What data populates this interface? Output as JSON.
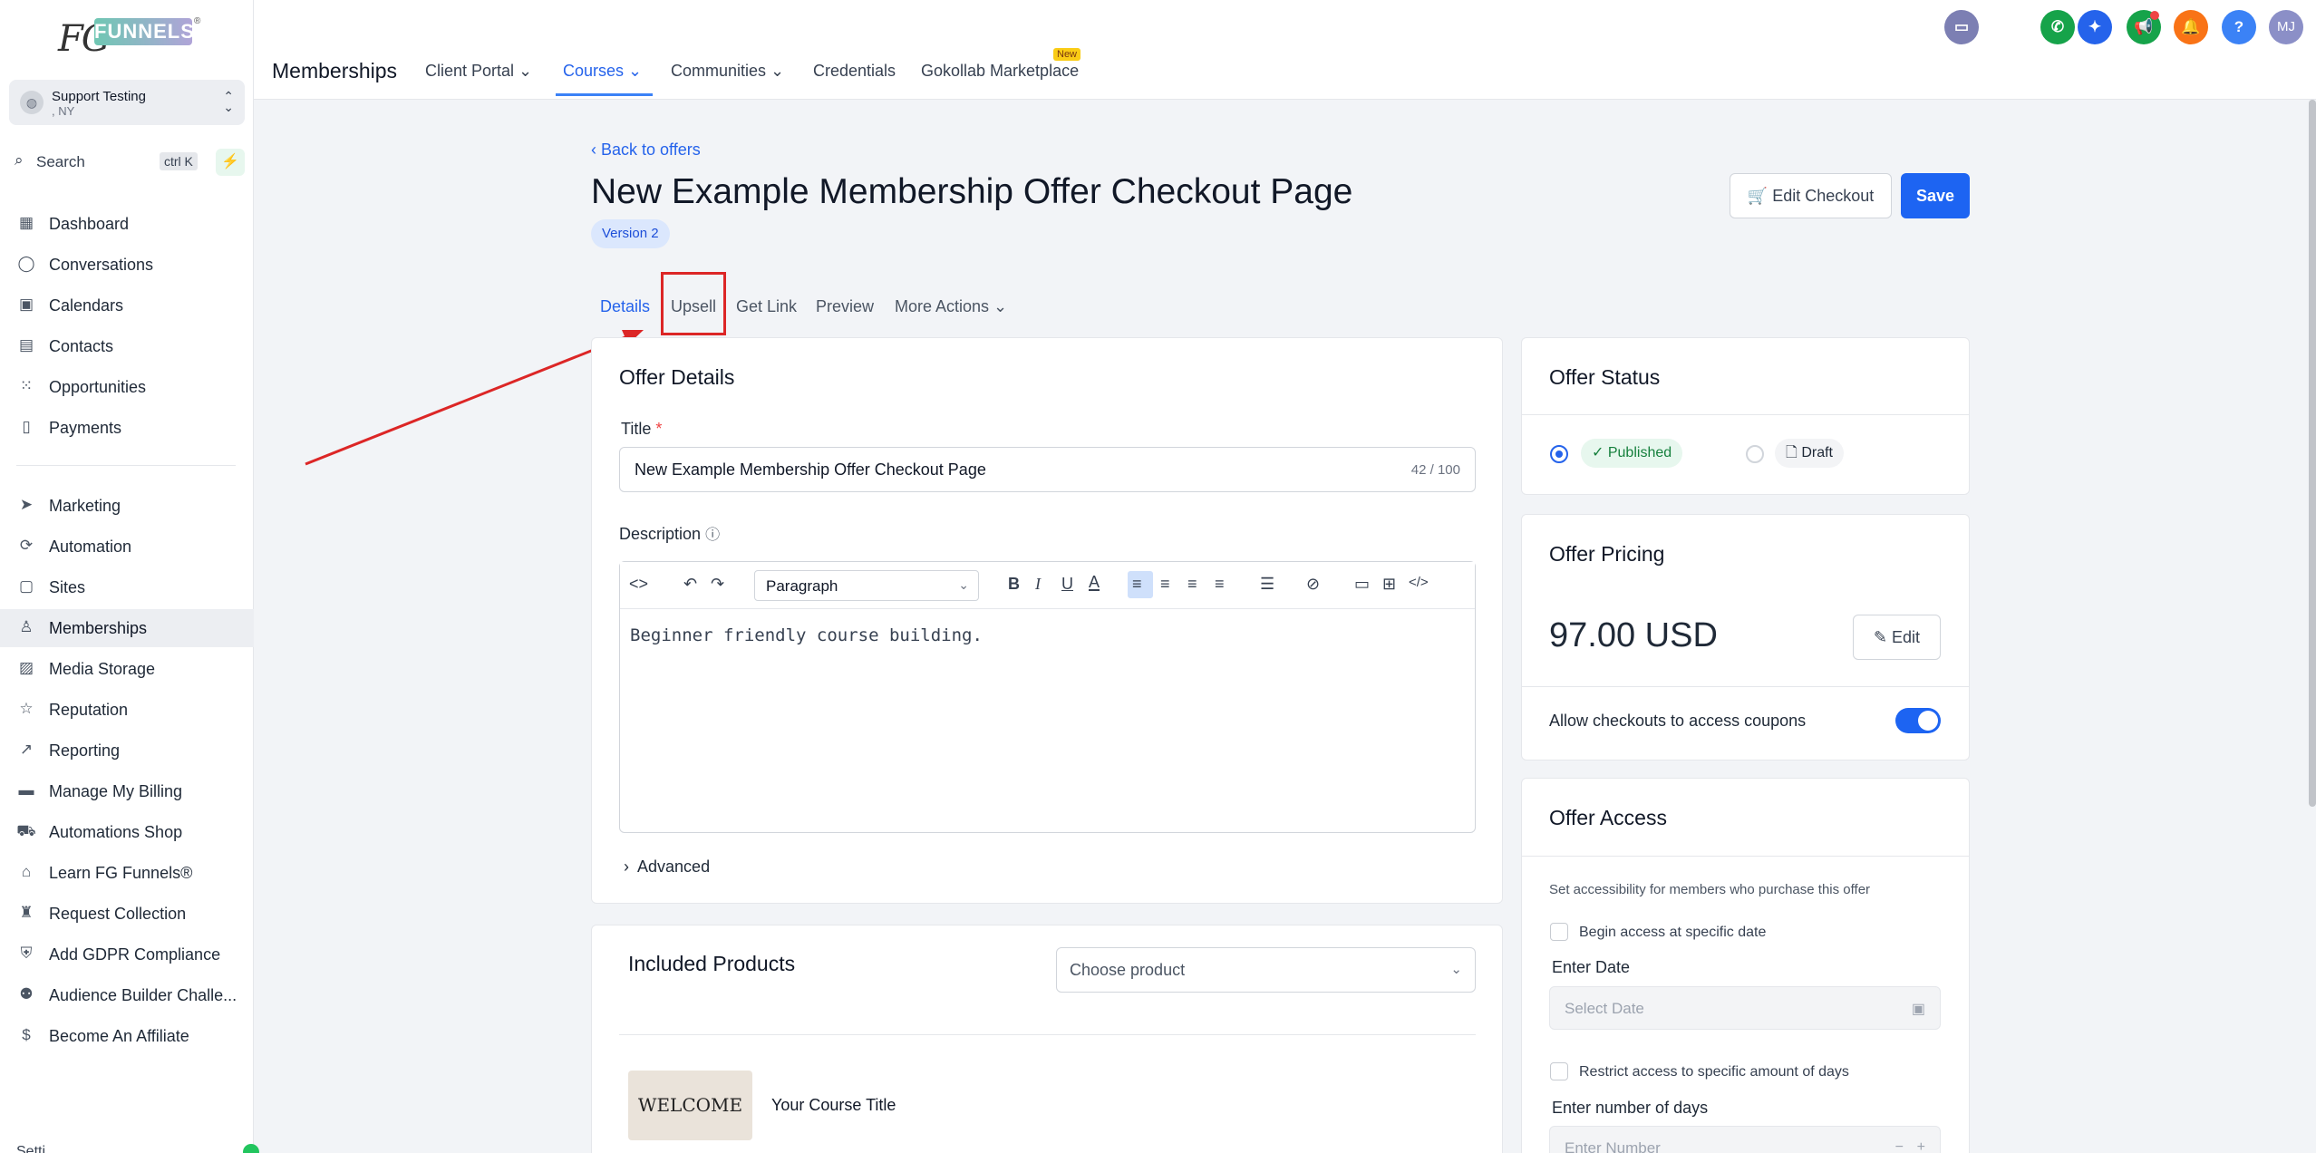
{
  "brand": {
    "logo_fg": "FG",
    "logo_funnels": "FUNNELS",
    "logo_mark": "®"
  },
  "account": {
    "name": "Support Testing",
    "location": ", NY"
  },
  "search": {
    "label": "Search",
    "shortcut": "ctrl K"
  },
  "sidebar": {
    "items": [
      {
        "label": "Dashboard",
        "icon": "dashboard-icon",
        "glyph": "▦"
      },
      {
        "label": "Conversations",
        "icon": "chat-icon",
        "glyph": "◯"
      },
      {
        "label": "Calendars",
        "icon": "calendar-icon",
        "glyph": "▣"
      },
      {
        "label": "Contacts",
        "icon": "contacts-icon",
        "glyph": "▤"
      },
      {
        "label": "Opportunities",
        "icon": "opportunities-icon",
        "glyph": "⁙"
      },
      {
        "label": "Payments",
        "icon": "payments-icon",
        "glyph": "▯"
      },
      {
        "label": "Marketing",
        "icon": "send-icon",
        "glyph": "➤"
      },
      {
        "label": "Automation",
        "icon": "automation-icon",
        "glyph": "⟳"
      },
      {
        "label": "Sites",
        "icon": "sites-icon",
        "glyph": "▢"
      },
      {
        "label": "Memberships",
        "icon": "membership-icon",
        "glyph": "♙"
      },
      {
        "label": "Media Storage",
        "icon": "image-icon",
        "glyph": "▨"
      },
      {
        "label": "Reputation",
        "icon": "star-icon",
        "glyph": "☆"
      },
      {
        "label": "Reporting",
        "icon": "trend-icon",
        "glyph": "↗"
      },
      {
        "label": "Manage My Billing",
        "icon": "billing-icon",
        "glyph": "▬"
      },
      {
        "label": "Automations Shop",
        "icon": "cart-icon",
        "glyph": "⛟"
      },
      {
        "label": "Learn FG Funnels®",
        "icon": "graduation-icon",
        "glyph": "⌂"
      },
      {
        "label": "Request Collection",
        "icon": "trophy-icon",
        "glyph": "♜"
      },
      {
        "label": "Add GDPR Compliance",
        "icon": "gdpr-icon",
        "glyph": "⛨"
      },
      {
        "label": "Audience Builder Challe...",
        "icon": "users-icon",
        "glyph": "⚉"
      },
      {
        "label": "Become An Affiliate",
        "icon": "dollar-icon",
        "glyph": "$"
      }
    ],
    "settings_stub": "Setti"
  },
  "header": {
    "title": "Memberships",
    "tabs": [
      {
        "label": "Client Portal ⌄"
      },
      {
        "label": "Courses ⌄"
      },
      {
        "label": "Communities ⌄"
      },
      {
        "label": "Credentials"
      },
      {
        "label": "Gokollab Marketplace"
      }
    ],
    "new_badge": "New",
    "avatar_initials": "MJ",
    "help": "?"
  },
  "page": {
    "back_link": "Back to offers",
    "title": "New Example Membership Offer Checkout Page",
    "version": "Version 2",
    "edit_checkout": "Edit Checkout",
    "save": "Save",
    "subtabs": [
      {
        "label": "Details"
      },
      {
        "label": "Upsell"
      },
      {
        "label": "Get Link"
      },
      {
        "label": "Preview"
      },
      {
        "label": "More Actions ⌄"
      }
    ]
  },
  "offer_details": {
    "heading": "Offer Details",
    "title_label": "Title",
    "required_mark": "*",
    "title_value": "New Example Membership Offer Checkout Page",
    "title_count": "42 / 100",
    "description_label": "Description",
    "paragraph_select": "Paragraph",
    "description_text": "Beginner friendly course building.",
    "advanced": "Advanced"
  },
  "included_products": {
    "heading": "Included Products",
    "choose_placeholder": "Choose product",
    "product_thumb_text": "WELCOME",
    "product_title": "Your Course Title"
  },
  "offer_status": {
    "heading": "Offer Status",
    "published": "Published",
    "draft": "Draft",
    "selected": "Published"
  },
  "offer_pricing": {
    "heading": "Offer Pricing",
    "price": "97.00 USD",
    "edit": "Edit",
    "coupons_label": "Allow checkouts to access coupons",
    "coupons_enabled": true
  },
  "offer_access": {
    "heading": "Offer Access",
    "description": "Set accessibility for members who purchase this offer",
    "begin_access_label": "Begin access at specific date",
    "enter_date_label": "Enter Date",
    "date_placeholder": "Select Date",
    "restrict_label": "Restrict access to specific amount of days",
    "days_label": "Enter number of days",
    "number_placeholder": "Enter Number"
  },
  "colors": {
    "accent": "#1d64f2",
    "annotation": "#dc2626",
    "published_green": "#15803d"
  }
}
